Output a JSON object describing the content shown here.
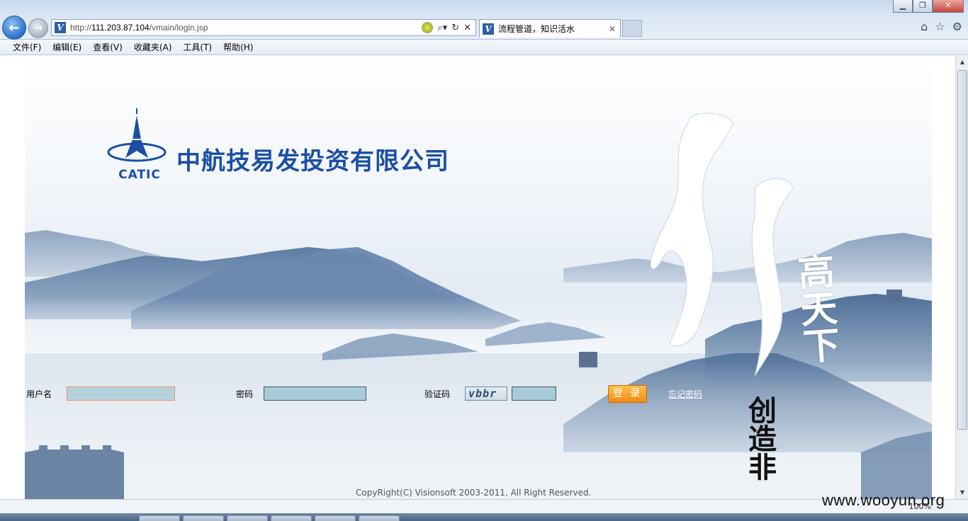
{
  "browser": {
    "url_prefix": "http://",
    "url_host": "111.203.87.104",
    "url_path": "/vmain/login.jsp",
    "tab_title": "流程管道，知识活水",
    "menu": [
      "文件(F)",
      "编辑(E)",
      "查看(V)",
      "收藏夹(A)",
      "工具(T)",
      "帮助(H)"
    ],
    "zoom": "100%",
    "icons": [
      "back-icon",
      "forward-icon",
      "search-icon",
      "refresh-icon",
      "stop-icon",
      "home-icon",
      "favorites-icon",
      "settings-icon"
    ]
  },
  "logo": {
    "mark_text": "CATIC",
    "company": "中航技易发投资有限公司"
  },
  "slogan": {
    "line1": "高天下",
    "line2": "创造非"
  },
  "form": {
    "username_label": "用户名",
    "username_value": "",
    "password_label": "密码",
    "password_value": "",
    "captcha_label": "验证码",
    "captcha_text": "vbbr",
    "captcha_value": "",
    "login_button": "登 录",
    "forgot_link": "忘记密码"
  },
  "footer": {
    "copyright": "CopyRight(C) Visionsoft 2003-2011, All Right Reserved."
  },
  "watermark": "www.wooyun.org",
  "colors": {
    "brand_blue": "#1a4fa5",
    "input_bg": "#a9cbd8",
    "button_orange": "#f08a12"
  }
}
